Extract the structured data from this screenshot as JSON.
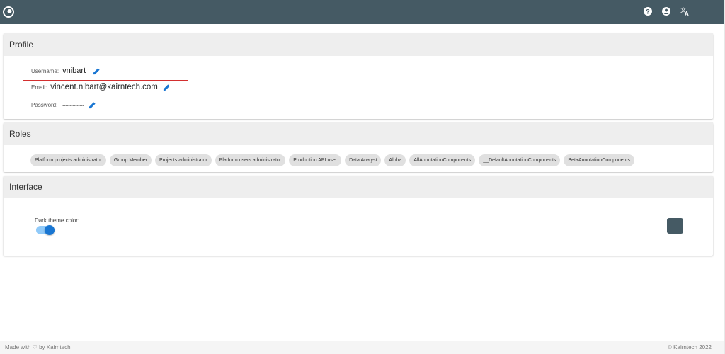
{
  "colors": {
    "header_bg": "#455a64",
    "accent": "#1976d2",
    "highlight_border": "#d32f2f",
    "theme_swatch": "#455a64"
  },
  "topbar": {
    "logo_icon": "eye-logo-icon",
    "icons": [
      "help-icon",
      "account-icon",
      "translate-icon"
    ]
  },
  "profile": {
    "title": "Profile",
    "username_label": "Username:",
    "username_value": "vnibart",
    "email_label": "Email:",
    "email_value": "vincent.nibart@kairntech.com",
    "password_label": "Password:",
    "password_value": "················"
  },
  "roles": {
    "title": "Roles",
    "items": [
      "Platform projects administrator",
      "Group Member",
      "Projects administrator",
      "Platform users administrator",
      "Production API user",
      "Data Analyst",
      "Alpha",
      "AllAnnotationComponents",
      "__DefaultAnnotationComponents",
      "BetaAnnotationComponents"
    ]
  },
  "interface": {
    "title": "Interface",
    "dark_theme_label": "Dark theme color:",
    "dark_theme_enabled": true
  },
  "footer": {
    "left": "Made with ♡ by Kairntech",
    "right": "©   Kairntech 2022"
  }
}
